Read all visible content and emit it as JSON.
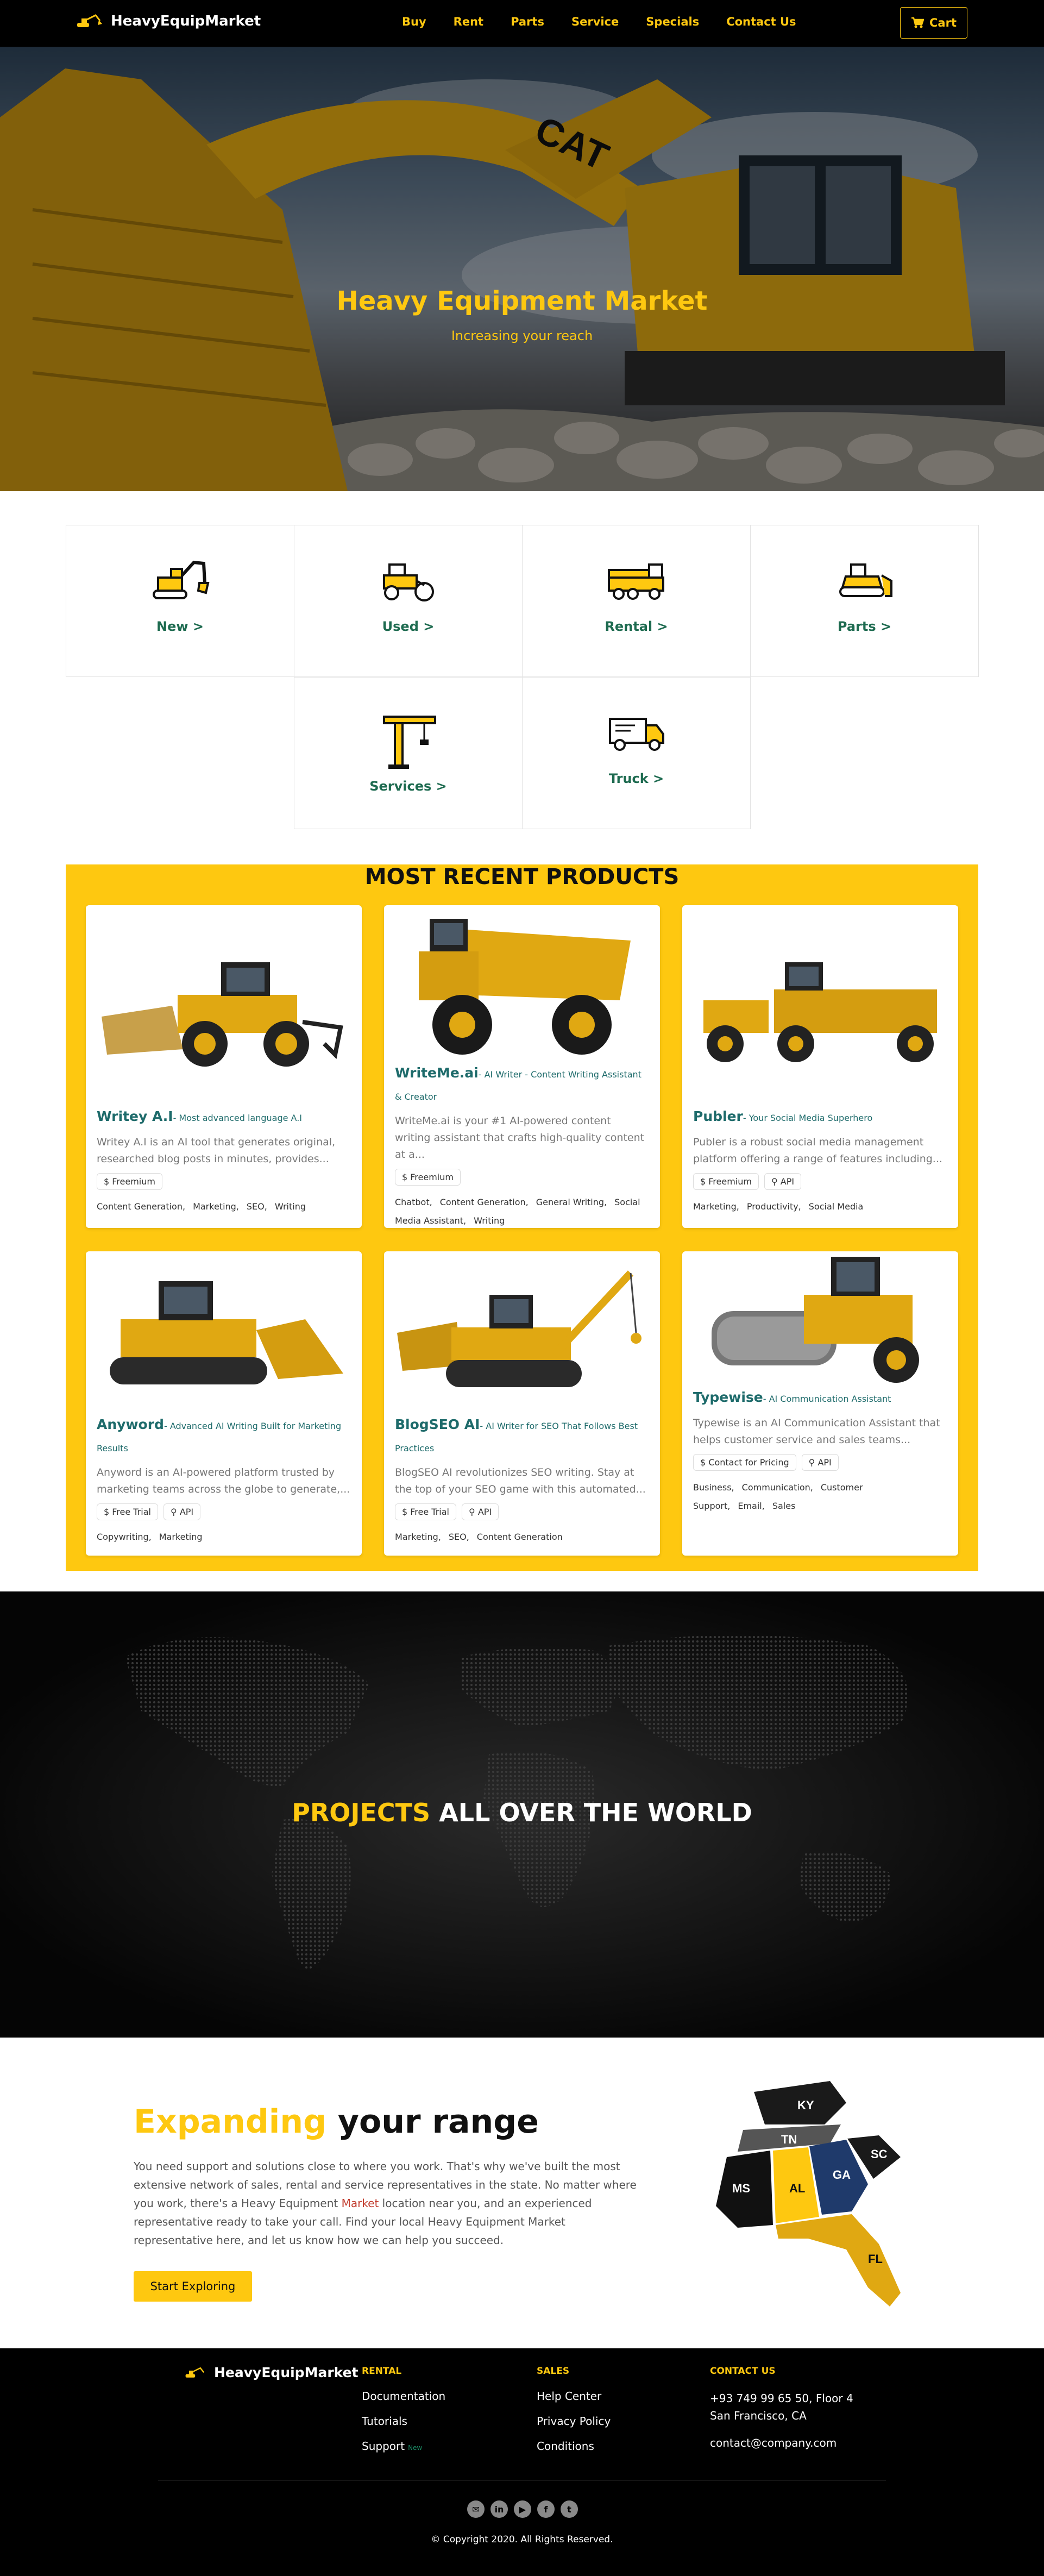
{
  "nav": {
    "brand": "HeavyEquipMarket",
    "items": [
      "Buy",
      "Rent",
      "Parts",
      "Service",
      "Specials",
      "Contact Us"
    ],
    "cart": "Cart"
  },
  "hero": {
    "title": "Heavy Equipment Market",
    "subtitle": "Increasing your reach",
    "logo_text": "CAT"
  },
  "categories": [
    {
      "label": "New >",
      "icon": "excavator-icon"
    },
    {
      "label": "Used >",
      "icon": "road-roller-icon"
    },
    {
      "label": "Rental >",
      "icon": "crane-truck-icon"
    },
    {
      "label": "Parts >",
      "icon": "bulldozer-icon"
    },
    {
      "label": "Services >",
      "icon": "tower-crane-icon"
    },
    {
      "label": "Truck >",
      "icon": "delivery-truck-icon"
    }
  ],
  "products": {
    "heading": "MOST RECENT PRODUCTS",
    "cards": [
      {
        "name": "Writey A.I",
        "tagline": "- Most advanced language A.I",
        "description": "Writey A.I is an AI tool that generates original, researched blog posts in minutes, provides...",
        "badges": [
          "Freemium"
        ],
        "tags": [
          "Content Generation,",
          "Marketing,",
          "SEO,",
          "Writing"
        ],
        "image": "wheel-dozer"
      },
      {
        "name": "WriteMe.ai",
        "tagline": "- AI Writer - Content Writing Assistant & Creator",
        "description": "WriteMe.ai is your #1 AI-powered content writing assistant that crafts high-quality content at a...",
        "badges": [
          "Freemium"
        ],
        "tags": [
          "Chatbot,",
          "Content Generation,",
          "General Writing,",
          "Social Media Assistant,",
          "Writing"
        ],
        "image": "dump-truck"
      },
      {
        "name": "Publer",
        "tagline": "- Your Social Media Superhero",
        "description": "Publer is a robust social media management platform offering a range of features including...",
        "badges": [
          "Freemium",
          "API"
        ],
        "tags": [
          "Marketing,",
          "Productivity,",
          "Social Media"
        ],
        "image": "wheel-tractor-scraper"
      },
      {
        "name": "Anyword",
        "tagline": "- Advanced AI Writing Built for Marketing Results",
        "description": "Anyword is an AI-powered platform trusted by marketing teams across the globe to generate,...",
        "badges": [
          "Free Trial",
          "API"
        ],
        "tags": [
          "Copywriting,",
          "Marketing"
        ],
        "image": "track-loader"
      },
      {
        "name": "BlogSEO AI",
        "tagline": "- AI Writer for SEO That Follows Best Practices",
        "description": "BlogSEO AI revolutionizes SEO writing. Stay at the top of your SEO game with this automated...",
        "badges": [
          "Free Trial",
          "API"
        ],
        "tags": [
          "Marketing,",
          "SEO,",
          "Content Generation"
        ],
        "image": "pipelayer"
      },
      {
        "name": "Typewise",
        "tagline": "- AI Communication Assistant",
        "description": "Typewise is an AI Communication Assistant that helps customer service and sales teams...",
        "badges": [
          "Contact for Pricing",
          "API"
        ],
        "tags": [
          "Business,",
          "Communication,",
          "Customer Support,",
          "Email,",
          "Sales"
        ],
        "image": "soil-compactor"
      }
    ]
  },
  "world": {
    "highlight": "PROJECTS",
    "rest": " ALL OVER THE WORLD"
  },
  "expand": {
    "highlight": "Expanding",
    "rest": " your range",
    "paragraph_before": "You need support and solutions close to where you work. That's why we've built the most extensive network of sales, rental and service representatives in the state. No matter where you work, there's a Heavy Equipment ",
    "paragraph_link": "Market",
    "paragraph_after": " location near you, and an experienced representative ready to take your call. Find your local Heavy Equipment Market representative here, and let us know how we can help you succeed.",
    "button": "Start Exploring",
    "states": [
      "KY",
      "TN",
      "MS",
      "AL",
      "GA",
      "SC",
      "FL"
    ]
  },
  "footer": {
    "brand": "HeavyEquipMarket",
    "columns": [
      {
        "title": "RENTAL",
        "links": [
          "Documentation",
          "Tutorials",
          "Support"
        ],
        "new_label": "New"
      },
      {
        "title": "SALES",
        "links": [
          "Help Center",
          "Privacy Policy",
          "Conditions"
        ]
      },
      {
        "title": "CONTACT US",
        "links": [
          "+93 749 99 65 50, Floor 4 San Francisco, CA",
          "contact@company.com"
        ]
      }
    ],
    "socials": [
      {
        "name": "mail-icon",
        "glyph": "✉"
      },
      {
        "name": "linkedin-icon",
        "glyph": "in"
      },
      {
        "name": "youtube-icon",
        "glyph": "▶"
      },
      {
        "name": "facebook-icon",
        "glyph": "f"
      },
      {
        "name": "twitter-icon",
        "glyph": "t"
      }
    ],
    "copyright": "© Copyright 2020. All Rights Reserved."
  },
  "colors": {
    "accent": "#fec810",
    "dark": "#000000",
    "teal": "#1e6b6b",
    "map_navy": "#1f3a6b"
  }
}
